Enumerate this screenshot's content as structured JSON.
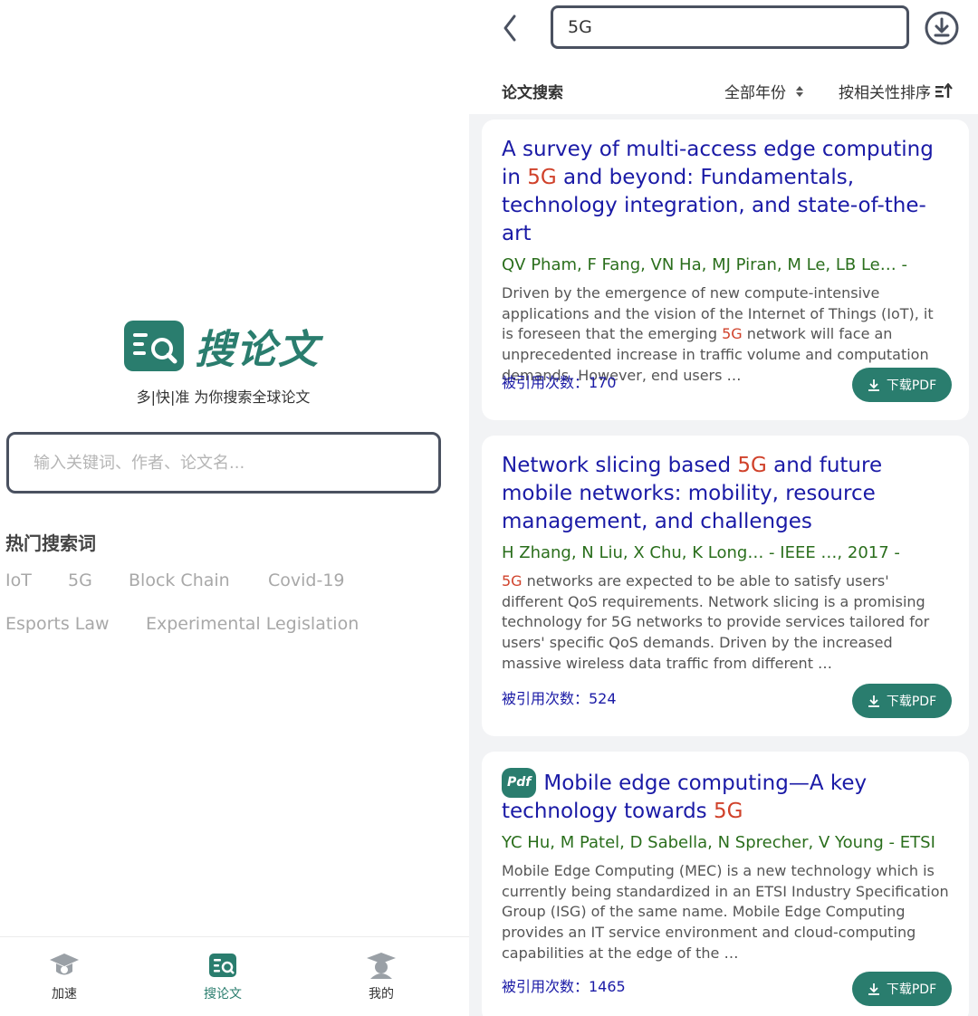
{
  "left": {
    "app_name": "搜论文",
    "slogan": "多|快|准 为你搜索全球论文",
    "search_placeholder": "输入关键词、作者、论文名...",
    "hot_title": "热门搜索词",
    "hot_tags": [
      "IoT",
      "5G",
      "Block Chain",
      "Covid-19",
      "Esports Law",
      "Experimental Legislation"
    ],
    "nav": [
      {
        "label": "加速",
        "icon": "graduation-cap-icon"
      },
      {
        "label": "搜论文",
        "icon": "search-paper-icon"
      },
      {
        "label": "我的",
        "icon": "user-cap-icon"
      }
    ]
  },
  "right": {
    "search_value": "5G",
    "filter_title": "论文搜索",
    "year_filter": "全部年份",
    "sort_label": "按相关性排序",
    "download_label": "下载PDF",
    "cards": [
      {
        "title_a": "A survey of multi-access edge computing in ",
        "title_hl": "5G",
        "title_b": " and beyond: Fundamentals, technology integration, and state-of-the-art",
        "authors": "QV Pham, F Fang, VN Ha, MJ Piran, M Le, LB Le… -",
        "abstract_a": "Driven by the emergence of new compute-intensive applications and the vision of the Internet of Things (IoT), it is foreseen that the emerging ",
        "abstract_hl": "5G",
        "abstract_b": " network will face an unprecedented increase in traffic volume and computation demands. However, end users …",
        "citations": "被引用次数：170"
      },
      {
        "title_a": "Network slicing based ",
        "title_hl": "5G",
        "title_b": " and future mobile networks: mobility, resource management, and challenges",
        "authors": "H Zhang, N Liu, X Chu, K Long… - IEEE …, 2017 -",
        "abstract_a": "",
        "abstract_hl": "5G",
        "abstract_b": " networks are expected to be able to satisfy users' different QoS requirements. Network slicing is a promising technology for 5G networks to provide services tailored for users' specific QoS demands. Driven by the increased massive wireless data traffic from different …",
        "citations": "被引用次数：524"
      },
      {
        "badge": "Pdf",
        "title_a": "Mobile edge computing—A key technology towards ",
        "title_hl": "5G",
        "title_b": "",
        "authors": "YC Hu, M Patel, D Sabella, N Sprecher, V Young - ETSI",
        "abstract_a": "Mobile Edge Computing (MEC) is a new technology which is currently being standardized in an ETSI Industry Specification Group (ISG) of the same name. Mobile Edge Computing provides an IT service environment and cloud-computing capabilities at the edge of the …",
        "abstract_hl": "",
        "abstract_b": "",
        "citations": "被引用次数：1465"
      }
    ]
  },
  "colors": {
    "brand": "#2a7d6e",
    "title": "#1a1aa6",
    "highlight": "#d0422b",
    "authors": "#2a6e1c"
  }
}
